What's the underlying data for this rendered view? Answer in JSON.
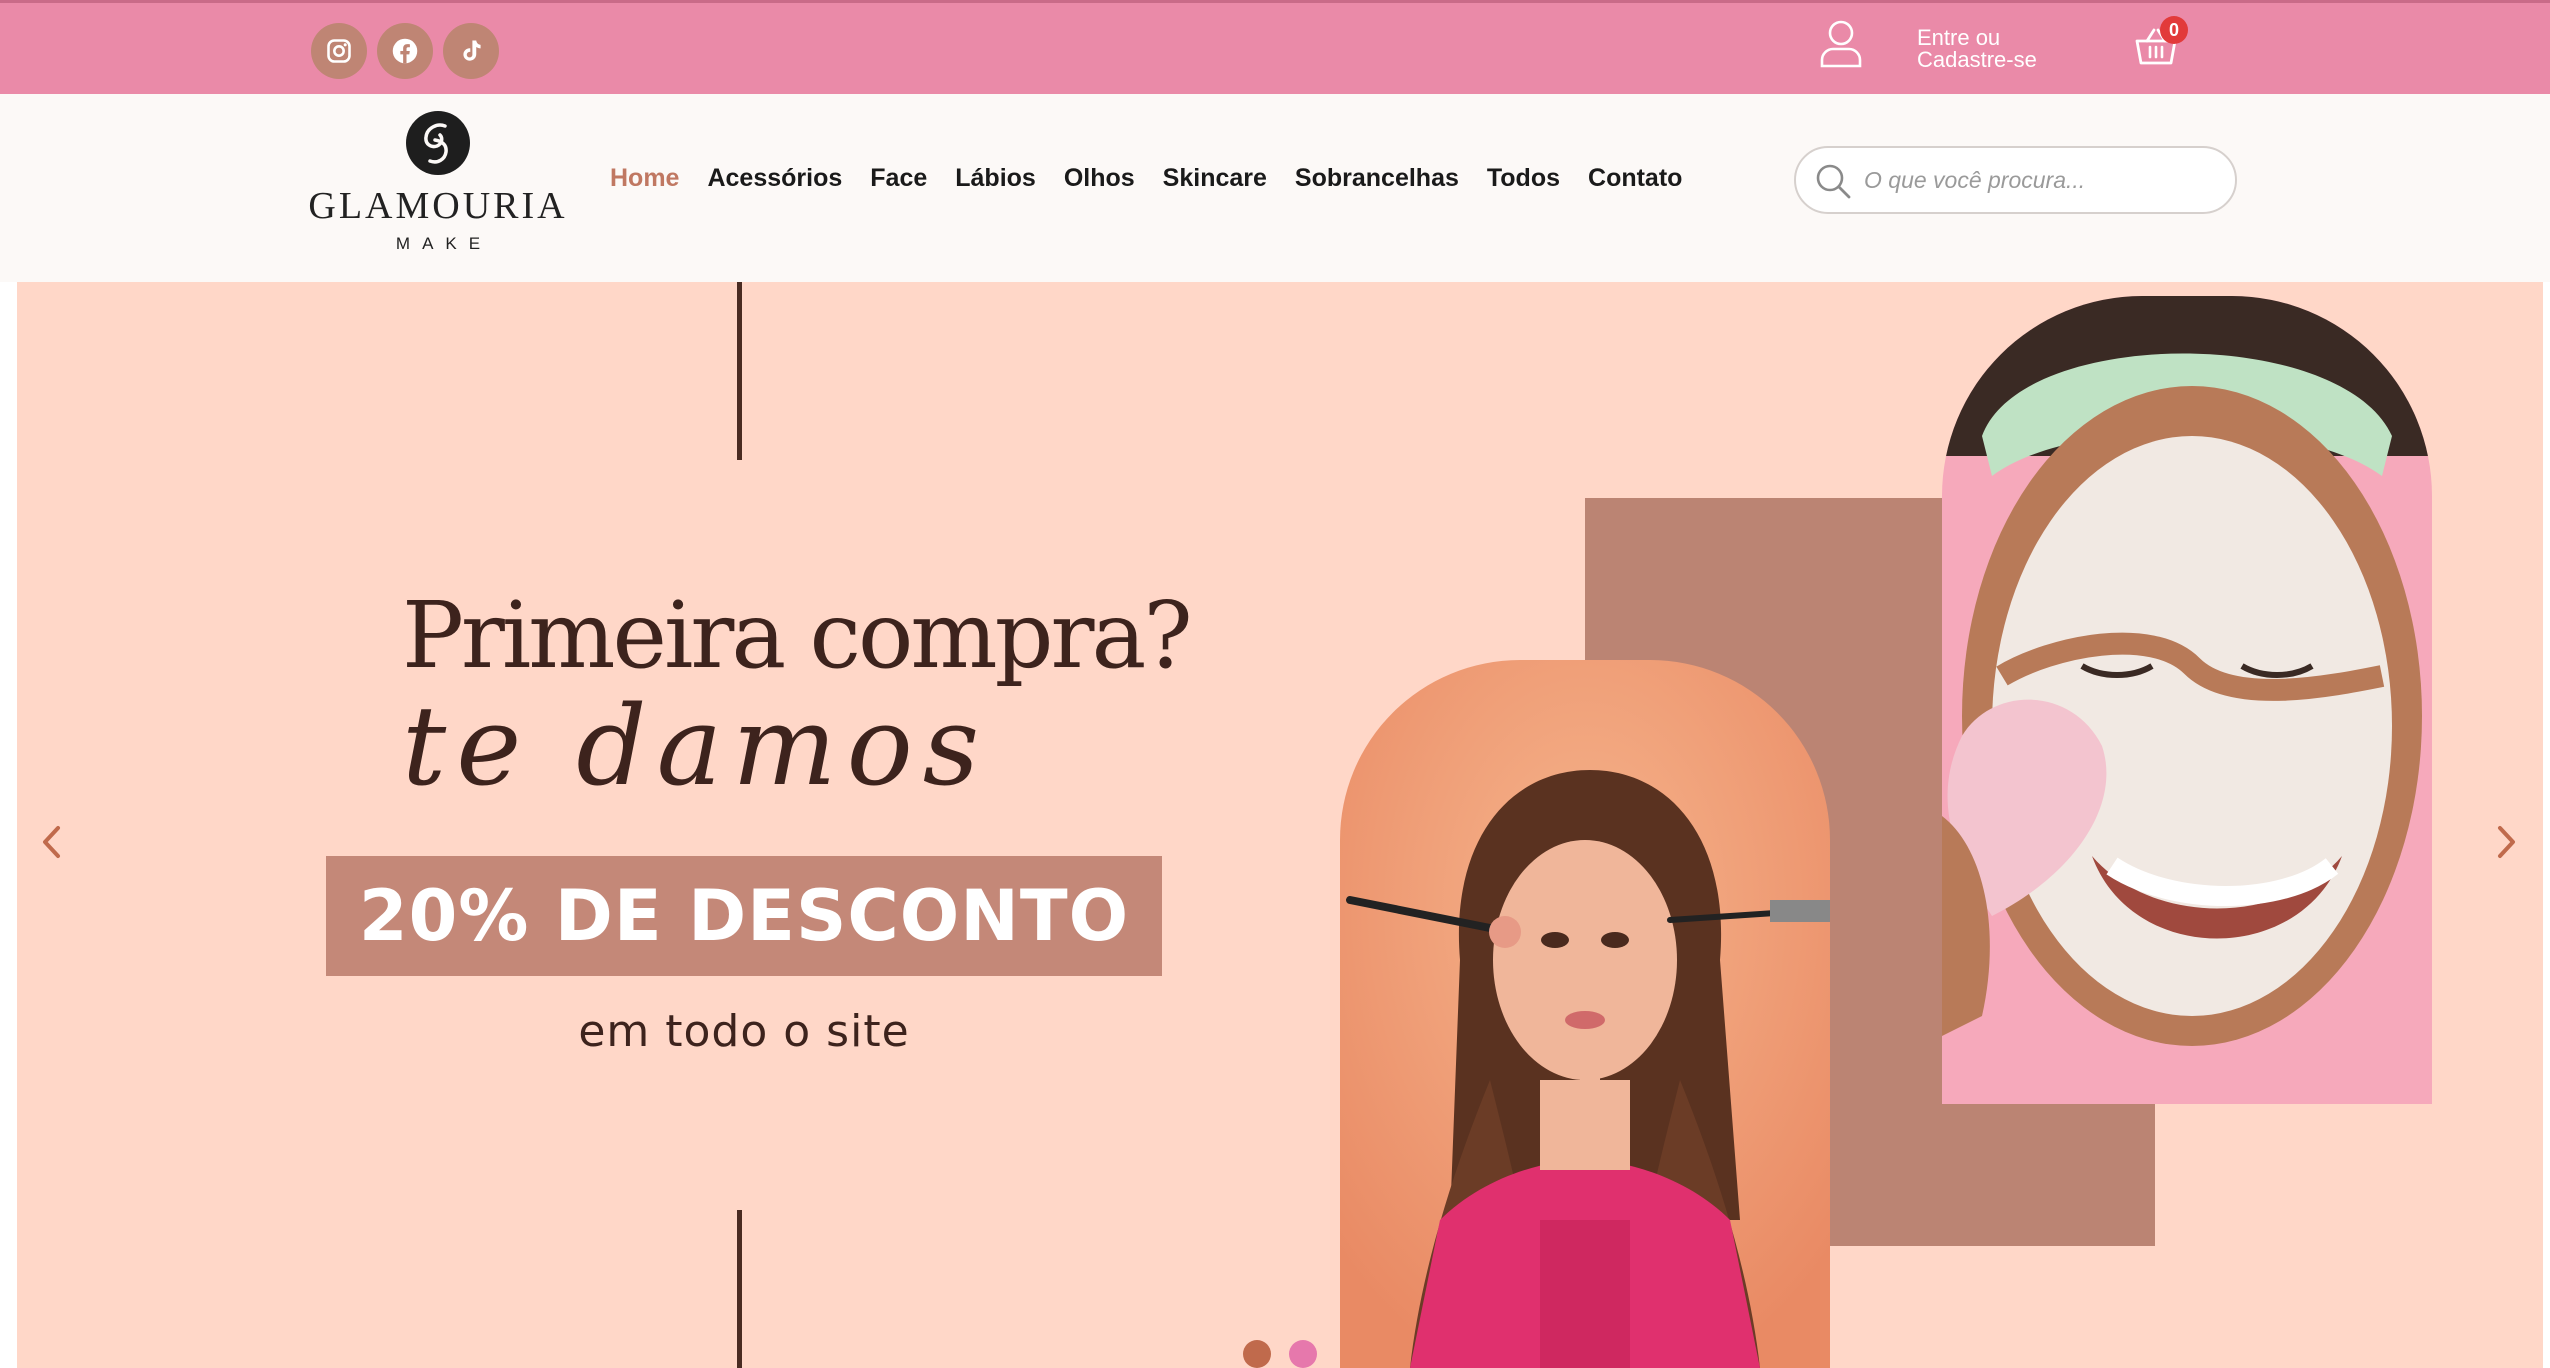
{
  "topbar": {
    "social": [
      {
        "name": "instagram-icon"
      },
      {
        "name": "facebook-icon"
      },
      {
        "name": "tiktok-icon"
      }
    ],
    "account_line1": "Entre ou",
    "account_line2": "Cadastre-se",
    "cart_count": "0",
    "colors": {
      "bar": "#ea8aa8",
      "social_bg": "#bf8574",
      "badge": "#e23a3a"
    }
  },
  "header": {
    "logo_word": "GLAMOURIA",
    "logo_sub": "MAKE",
    "nav": [
      {
        "label": "Home",
        "active": true
      },
      {
        "label": "Acessórios",
        "active": false
      },
      {
        "label": "Face",
        "active": false
      },
      {
        "label": "Lábios",
        "active": false
      },
      {
        "label": "Olhos",
        "active": false
      },
      {
        "label": "Skincare",
        "active": false
      },
      {
        "label": "Sobrancelhas",
        "active": false
      },
      {
        "label": "Todos",
        "active": false
      },
      {
        "label": "Contato",
        "active": false
      }
    ],
    "search_placeholder": "O que você procura...",
    "colors": {
      "active_nav": "#c07862"
    }
  },
  "hero": {
    "headline1": "Primeira compra?",
    "headline2": "te damos",
    "promo": "20% DE DESCONTO",
    "promo_sub": "em todo o site",
    "slides_total": 2,
    "active_slide": 1,
    "colors": {
      "bg": "#ffd7c8",
      "promo_box": "#c48878",
      "dot_active": "#c06a4c",
      "dot_inactive": "#e678ac"
    }
  }
}
